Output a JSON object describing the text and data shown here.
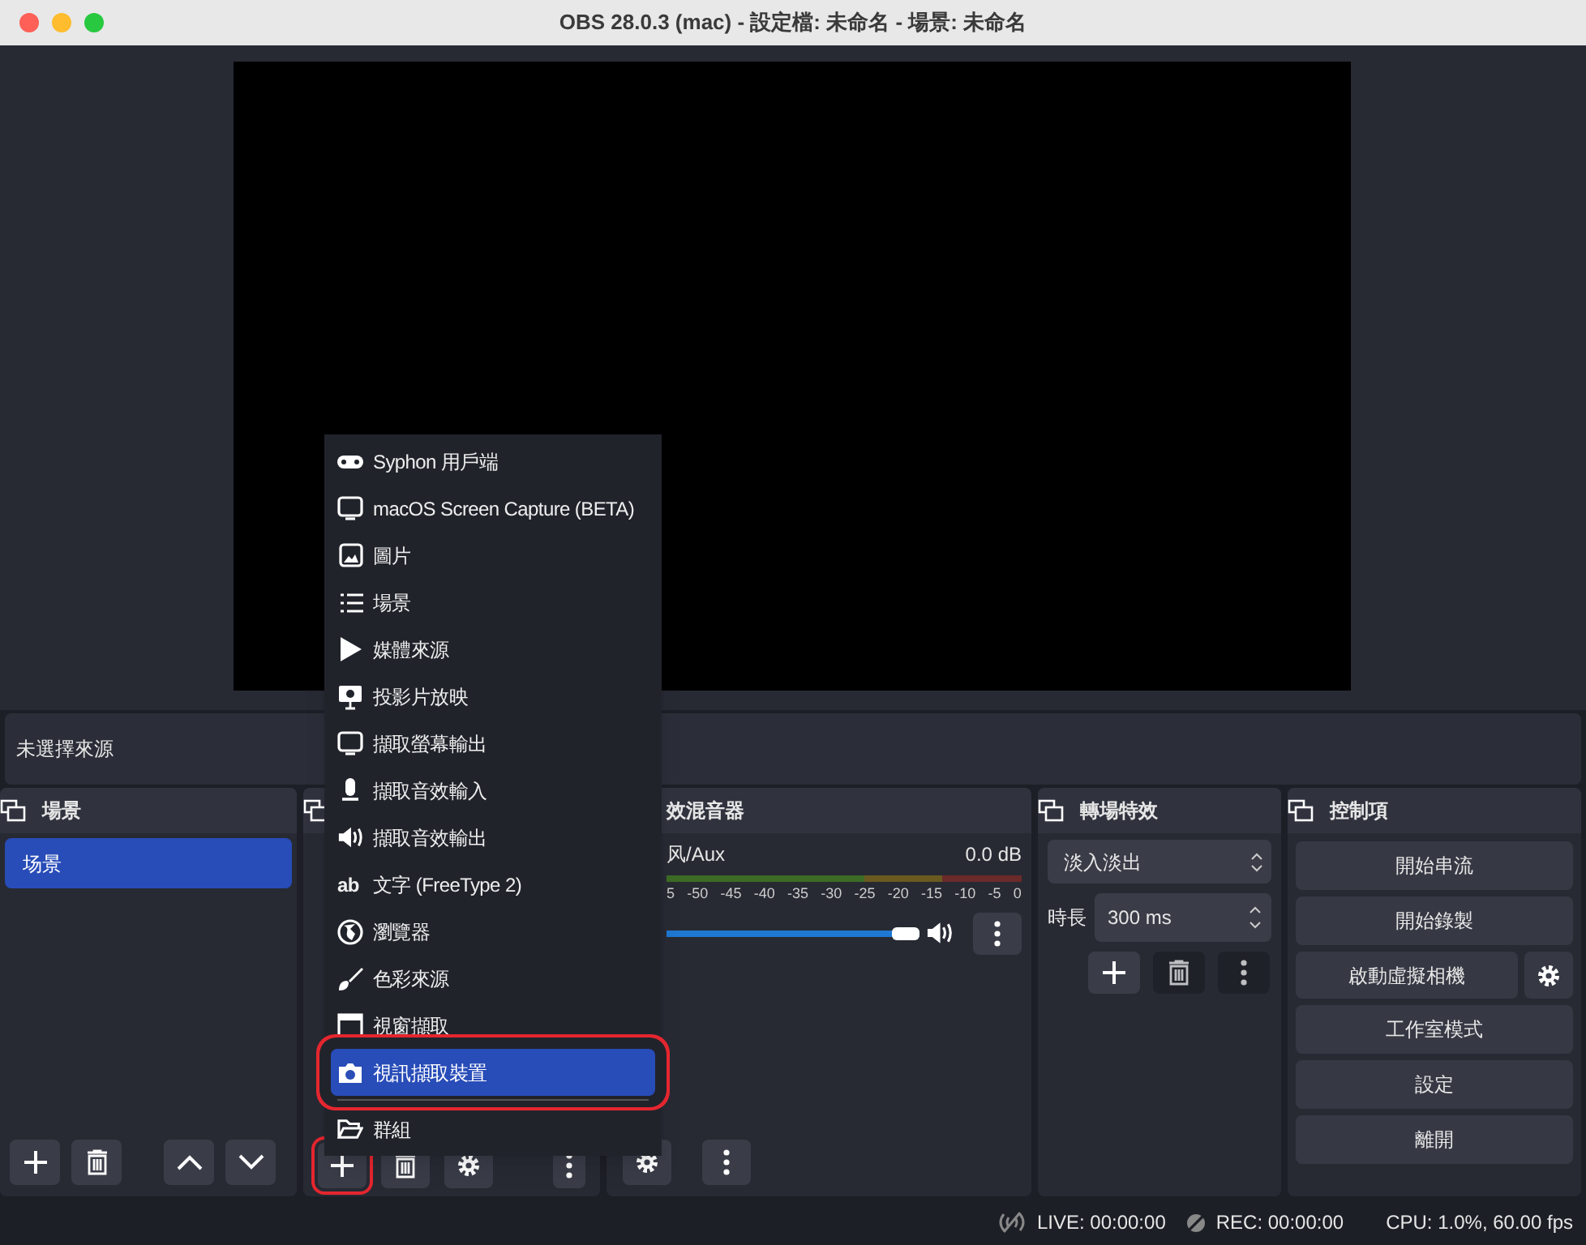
{
  "window": {
    "title": "OBS 28.0.3 (mac) - 設定檔: 未命名 - 場景: 未命名"
  },
  "source_bar": {
    "text": "未選擇來源"
  },
  "scenes": {
    "title": "場景",
    "items": [
      {
        "label": "场景",
        "selected": true
      }
    ],
    "buttons": [
      {
        "kind": "add"
      },
      {
        "kind": "remove"
      },
      {
        "kind": "up"
      },
      {
        "kind": "down"
      }
    ]
  },
  "sources": {
    "buttons": [
      {
        "kind": "add",
        "annotated": true
      },
      {
        "kind": "remove"
      },
      {
        "kind": "settings"
      },
      {
        "kind": "more"
      }
    ]
  },
  "mixer": {
    "title": "效混音器",
    "channels": [
      {
        "name": "风/Aux",
        "reading": "0.0 dB",
        "level": 1,
        "muted": false,
        "ticks": [
          "5",
          "-50",
          "-45",
          "-40",
          "-35",
          "-30",
          "-25",
          "-20",
          "-15",
          "-10",
          "-5",
          "0"
        ]
      }
    ],
    "buttons": [
      {
        "kind": "settings"
      },
      {
        "kind": "more"
      }
    ]
  },
  "transitions": {
    "title": "轉場特效",
    "selected": "淡入淡出",
    "duration_label": "時長",
    "duration": "300 ms",
    "buttons": [
      {
        "kind": "add",
        "disabled": false
      },
      {
        "kind": "remove",
        "disabled": true
      },
      {
        "kind": "more",
        "disabled": true
      }
    ]
  },
  "controls": {
    "title": "控制項",
    "buttons": [
      {
        "label": "開始串流",
        "kind": "plain"
      },
      {
        "label": "開始錄製",
        "kind": "plain"
      },
      {
        "label": "啟動虛擬相機",
        "kind": "with_settings"
      },
      {
        "label": "工作室模式",
        "kind": "plain"
      },
      {
        "label": "設定",
        "kind": "plain"
      },
      {
        "label": "離開",
        "kind": "plain"
      }
    ]
  },
  "status_bar": {
    "live": "LIVE: 00:00:00",
    "rec": "REC: 00:00:00",
    "cpu": "CPU: 1.0%, 60.00 fps"
  },
  "add_source_menu": {
    "items": [
      {
        "kind": "gamepad",
        "label": "Syphon 用戶端",
        "selected": false,
        "annotated": false
      },
      {
        "kind": "monitor",
        "label": "macOS Screen Capture (BETA)",
        "selected": false,
        "annotated": false
      },
      {
        "kind": "image",
        "label": "圖片",
        "selected": false,
        "annotated": false
      },
      {
        "kind": "list",
        "label": "場景",
        "selected": false,
        "annotated": false
      },
      {
        "kind": "play",
        "label": "媒體來源",
        "selected": false,
        "annotated": false
      },
      {
        "kind": "slideshow",
        "label": "投影片放映",
        "selected": false,
        "annotated": false
      },
      {
        "kind": "monitor",
        "label": "擷取螢幕輸出",
        "selected": false,
        "annotated": false
      },
      {
        "kind": "mic",
        "label": "擷取音效輸入",
        "selected": false,
        "annotated": false
      },
      {
        "kind": "speaker",
        "label": "擷取音效輸出",
        "selected": false,
        "annotated": false
      },
      {
        "kind": "text",
        "icon_text": "ab",
        "label": "文字 (FreeType 2)",
        "selected": false,
        "annotated": false
      },
      {
        "kind": "globe",
        "label": "瀏覽器",
        "selected": false,
        "annotated": false
      },
      {
        "kind": "brush",
        "label": "色彩來源",
        "selected": false,
        "annotated": false
      },
      {
        "kind": "window",
        "label": "視窗擷取",
        "selected": false,
        "annotated": false
      },
      {
        "kind": "camera",
        "label": "視訊擷取裝置",
        "selected": true,
        "annotated": true
      },
      {
        "kind": "separator"
      },
      {
        "kind": "folder",
        "label": "群組",
        "selected": false,
        "annotated": false
      }
    ]
  }
}
